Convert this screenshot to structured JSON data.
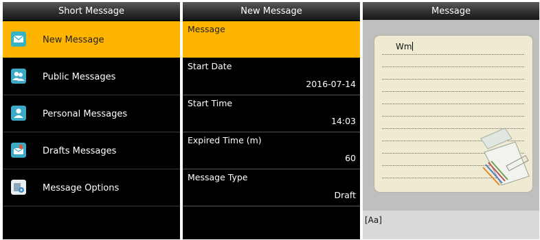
{
  "short_message": {
    "title": "Short Message",
    "items": [
      {
        "label": "New Message",
        "icon": "new-message-icon",
        "selected": true
      },
      {
        "label": "Public Messages",
        "icon": "public-messages-icon",
        "selected": false
      },
      {
        "label": "Personal Messages",
        "icon": "personal-messages-icon",
        "selected": false
      },
      {
        "label": "Drafts Messages",
        "icon": "drafts-messages-icon",
        "selected": false
      },
      {
        "label": "Message Options",
        "icon": "message-options-icon",
        "selected": false
      }
    ]
  },
  "new_message": {
    "title": "New Message",
    "fields": [
      {
        "label": "Message",
        "value": "",
        "selected": true
      },
      {
        "label": "Start Date",
        "value": "2016-07-14",
        "selected": false
      },
      {
        "label": "Start Time",
        "value": "14:03",
        "selected": false
      },
      {
        "label": "Expired Time (m)",
        "value": "60",
        "selected": false
      },
      {
        "label": "Message Type",
        "value": "Draft",
        "selected": false
      }
    ]
  },
  "message": {
    "title": "Message",
    "text": "Wm",
    "input_mode": "[Aa]"
  },
  "colors": {
    "highlight": "#ffb400",
    "background": "#000000",
    "note_paper": "#efead2"
  }
}
